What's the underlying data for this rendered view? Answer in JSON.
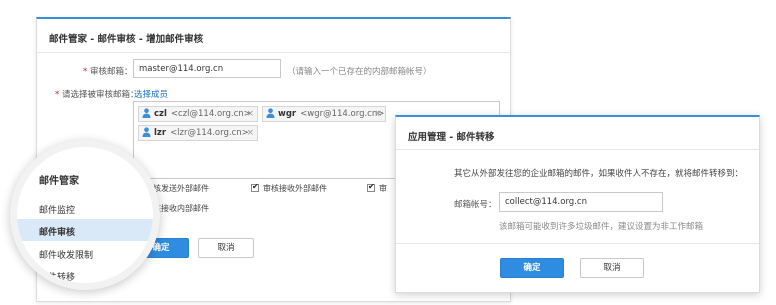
{
  "left_panel": {
    "title": "邮件管家 - 邮件审核 - 增加邮件审核",
    "auditor_label": "审核邮箱：",
    "auditor_value": "master@114.org.cn",
    "auditor_hint": "（请输入一个已存在的内部邮箱帐号）",
    "members_label": "请选择被审核邮箱：",
    "members_link": "选择成员",
    "members": [
      {
        "name": "czl",
        "email": "<czl@114.org.cn>"
      },
      {
        "name": "wgr",
        "email": "<wgr@114.org.cn>"
      },
      {
        "name": "lzr",
        "email": "<lzr@114.org.cn>"
      }
    ],
    "checkboxes": [
      {
        "label": "审核发送外部邮件",
        "checked": true
      },
      {
        "label": "审核接收外部邮件",
        "checked": true
      },
      {
        "label": "审",
        "checked": true
      },
      {
        "label": "审核接收内部邮件",
        "checked": false
      }
    ],
    "confirm": "确定",
    "cancel": "取消"
  },
  "magnifier": {
    "title": "邮件管家",
    "items": [
      {
        "label": "邮件监控",
        "active": false
      },
      {
        "label": "邮件审核",
        "active": true
      },
      {
        "label": "邮件收发限制",
        "active": false
      },
      {
        "label": "邮件转移",
        "active": false
      }
    ]
  },
  "right_panel": {
    "title": "应用管理 - 邮件转移",
    "desc": "其它从外部发往您的企业邮箱的邮件，如果收件人不存在，就将邮件转移到：",
    "account_label": "邮箱帐号：",
    "account_value": "collect@114.org.cn",
    "account_hint": "该邮箱可能收到许多垃圾邮件，建议设置为非工作邮箱",
    "confirm": "确定",
    "cancel": "取消"
  },
  "colors": {
    "accent": "#2e8de0",
    "required": "#e02020",
    "link": "#1a73c9",
    "active_menu_bg": "#d9e9f7"
  }
}
